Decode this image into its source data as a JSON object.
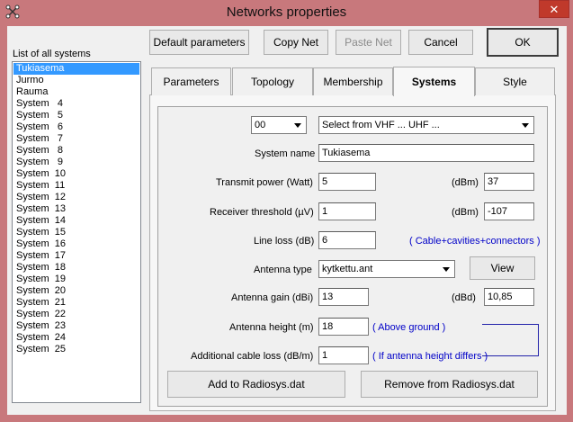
{
  "window": {
    "title": "Networks properties",
    "close_label": "✕"
  },
  "list": {
    "label": "List of all systems",
    "items": [
      "Tukiasema",
      "Jurmo",
      "Rauma",
      "System   4",
      "System   5",
      "System   6",
      "System   7",
      "System   8",
      "System   9",
      "System  10",
      "System  11",
      "System  12",
      "System  13",
      "System  14",
      "System  15",
      "System  16",
      "System  17",
      "System  18",
      "System  19",
      "System  20",
      "System  21",
      "System  22",
      "System  23",
      "System  24",
      "System  25"
    ],
    "selected_index": 0
  },
  "toolbar": {
    "default_parameters": "Default parameters",
    "copy_net": "Copy Net",
    "paste_net": "Paste Net",
    "cancel": "Cancel",
    "ok": "OK"
  },
  "tabs": [
    "Parameters",
    "Topology",
    "Membership",
    "Systems",
    "Style"
  ],
  "active_tab": 3,
  "form": {
    "system_number": "00",
    "band_select": "Select from VHF ... UHF ...",
    "system_name_label": "System name",
    "system_name": "Tukiasema",
    "tx_power_label": "Transmit power (Watt)",
    "tx_power": "5",
    "dbm_label": "(dBm)",
    "tx_power_dbm": "37",
    "rx_threshold_label": "Receiver threshold (µV)",
    "rx_threshold": "1",
    "rx_threshold_dbm": "-107",
    "line_loss_label": "Line loss (dB)",
    "line_loss": "6",
    "line_loss_note": "( Cable+cavities+connectors )",
    "antenna_type_label": "Antenna type",
    "antenna_type": "kytkettu.ant",
    "view_button": "View",
    "antenna_gain_label": "Antenna gain (dBi)",
    "antenna_gain": "13",
    "dbd_label": "(dBd)",
    "antenna_gain_dbd": "10,85",
    "antenna_height_label": "Antenna height (m)",
    "antenna_height": "18",
    "antenna_height_note": "( Above ground )",
    "cable_loss_label": "Additional cable loss (dB/m)",
    "cable_loss": "1",
    "cable_loss_note": "( If antenna height differs )",
    "add_button": "Add to Radiosys.dat",
    "remove_button": "Remove from Radiosys.dat"
  }
}
